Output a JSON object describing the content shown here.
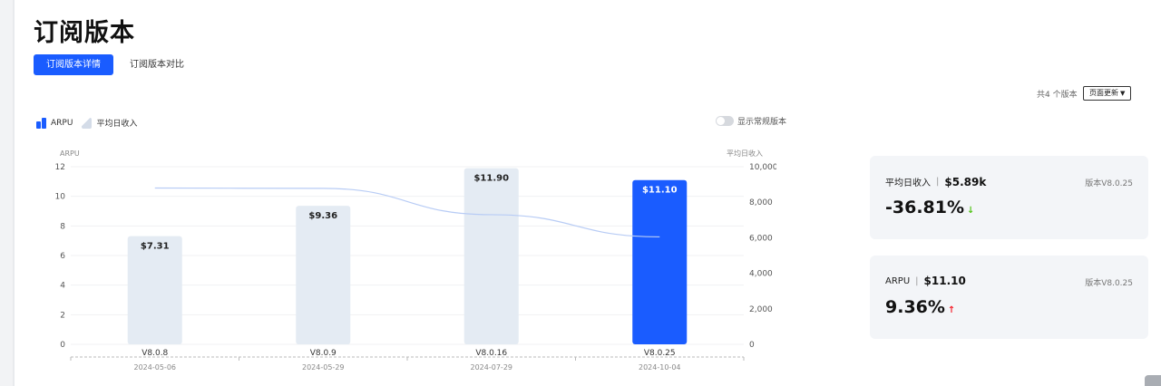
{
  "page": {
    "title": "订阅版本",
    "tabs": [
      {
        "label": "订阅版本详情",
        "active": true
      },
      {
        "label": "订阅版本对比",
        "active": false
      }
    ],
    "version_count": "共4 个版本",
    "update_button": "页面更新",
    "legend": [
      {
        "label": "ARPU",
        "icon": "bar-chart-icon"
      },
      {
        "label": "平均日收入",
        "icon": "area-chart-icon"
      }
    ],
    "toggle_label": "显示常规版本"
  },
  "cards": [
    {
      "label": "平均日收入",
      "value": "$5.89k",
      "version": "版本V8.0.25",
      "change": "-36.81%",
      "direction": "down",
      "arrow": "↓"
    },
    {
      "label": "ARPU",
      "value": "$11.10",
      "version": "版本V8.0.25",
      "change": "9.36%",
      "direction": "up",
      "arrow": "↑"
    }
  ],
  "colors": {
    "accent": "#1a5cff",
    "bar": "#e4ebf3",
    "line": "#b8ccf5",
    "down": "#52c41a",
    "up": "#f5222d"
  },
  "chart_data": {
    "type": "bar",
    "categories": [
      "V8.0.8",
      "V8.0.9",
      "V8.0.16",
      "V8.0.25"
    ],
    "dates": [
      "2024-05-06",
      "2024-05-29",
      "2024-07-29",
      "2024-10-04"
    ],
    "ylabel": "ARPU",
    "y2label": "平均日收入",
    "ylim": [
      0,
      12
    ],
    "y2lim": [
      0,
      10000
    ],
    "yticks": [
      "0",
      "2",
      "4",
      "6",
      "8",
      "10",
      "12"
    ],
    "y2ticks": [
      "0",
      "2,000",
      "4,000",
      "6,000",
      "8,000",
      "10,000"
    ],
    "series": [
      {
        "name": "ARPU",
        "type": "bar",
        "values": [
          7.31,
          9.36,
          11.9,
          11.1
        ],
        "labels": [
          "$7.31",
          "$9.36",
          "$11.90",
          "$11.10"
        ],
        "highlight_index": 3
      },
      {
        "name": "平均日收入",
        "type": "line",
        "axis": "right",
        "values": [
          8800,
          8780,
          7300,
          6050
        ]
      }
    ],
    "grid": true,
    "legend_position": "top-left"
  }
}
